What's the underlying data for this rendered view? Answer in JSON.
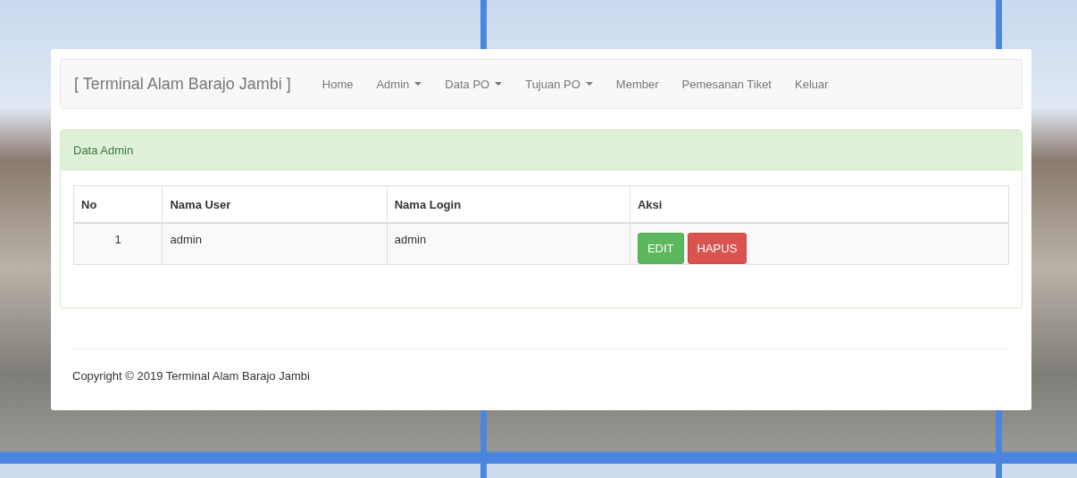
{
  "navbar": {
    "brand": "[ Terminal Alam Barajo Jambi ]",
    "items": [
      {
        "label": "Home",
        "dropdown": false
      },
      {
        "label": "Admin",
        "dropdown": true
      },
      {
        "label": "Data PO",
        "dropdown": true
      },
      {
        "label": "Tujuan PO",
        "dropdown": true
      },
      {
        "label": "Member",
        "dropdown": false
      },
      {
        "label": "Pemesanan Tiket",
        "dropdown": false
      },
      {
        "label": "Keluar",
        "dropdown": false
      }
    ]
  },
  "panel": {
    "title": "Data Admin",
    "table": {
      "columns": [
        "No",
        "Nama User",
        "Nama Login",
        "Aksi"
      ],
      "rows": [
        {
          "no": "1",
          "nama_user": "admin",
          "nama_login": "admin",
          "actions": [
            {
              "label": "EDIT",
              "kind": "edit"
            },
            {
              "label": "HAPUS",
              "kind": "delete"
            }
          ]
        }
      ]
    }
  },
  "footer": {
    "text": "Copyright © 2019 Terminal Alam Barajo Jambi"
  }
}
